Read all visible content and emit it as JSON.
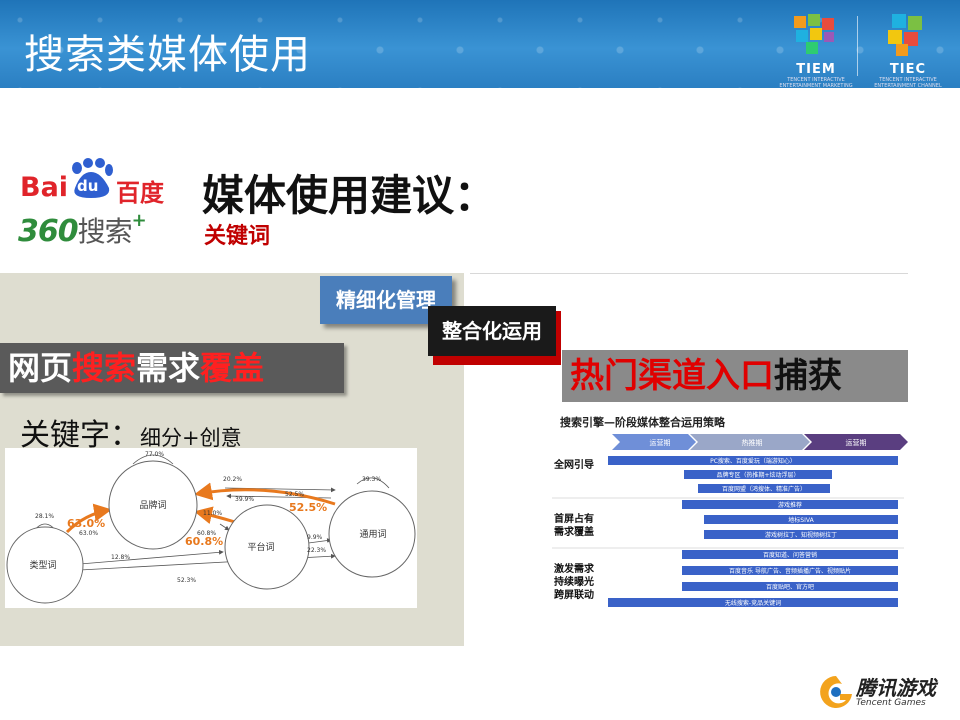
{
  "header": {
    "title": "搜索类媒体使用",
    "logos": [
      {
        "label": "TIEM",
        "sub": "TENCENT INTERACTIVE ENTERTAINMENT MARKETING"
      },
      {
        "label": "TIEC",
        "sub": "TENCENT INTERACTIVE ENTERTAINMENT CHANNEL DEPARTMENT"
      }
    ]
  },
  "brands": {
    "baidu_a": "Bai",
    "baidu_du": "du",
    "baidu_cn": "百度",
    "s360_num": "360",
    "s360_cn": "搜索",
    "s360_plus": "+"
  },
  "main": {
    "heading": "媒体使用建议：",
    "keyword": "关键词"
  },
  "tags": {
    "fine": "精细化管理",
    "integrate": "整合化运用"
  },
  "left": {
    "banner_p1": "网页",
    "banner_p2": "搜索",
    "banner_p3": "需求",
    "banner_p4": "覆盖",
    "kw_label": "关键字：",
    "kw_detail": "细分+创意",
    "network": {
      "nodes": [
        "品牌词",
        "平台词",
        "通用词",
        "类型词"
      ],
      "values": [
        "77.0%",
        "39.3%",
        "28.1%",
        "63.0%",
        "63.0%",
        "20.2%",
        "39.9%",
        "11.0%",
        "52.5%",
        "52.5%",
        "60.8%",
        "60.8%",
        "9.9%",
        "22.3%",
        "12.8%",
        "52.3%"
      ]
    }
  },
  "right": {
    "banner_p1": "热门渠道",
    "banner_p2": "入口",
    "banner_p3": "捕获",
    "strategy": {
      "title": "搜索引擎—阶段媒体整合运用策略",
      "phases": [
        "运营期",
        "热推期",
        "运营期"
      ],
      "rows": [
        {
          "label": "全网引导",
          "bars": [
            "PC搜索、百度爱玩（端游知心）",
            "品牌专区（热推期+炫动浮层）",
            "百度网盟（鸿搜体、精准广告）"
          ]
        },
        {
          "label": "首屏占有\n需求覆盖",
          "bars": [
            "游戏推荐",
            "地标SIVA",
            "游戏树拉丁、知视频树拉丁"
          ]
        },
        {
          "label": "激发需求\n持续曝光\n跨屏联动",
          "bars": [
            "百度知道、问答营销",
            "百度音乐 导航广告、音频插播广告、视频贴片",
            "百度贴吧、官方吧",
            "无线搜索-竞品关键词"
          ]
        }
      ]
    }
  },
  "footer": {
    "brand_cn": "腾讯游戏",
    "brand_en": "Tencent Games"
  },
  "colors": {
    "header_blue": "#2b7fc2",
    "accent_red": "#c00000",
    "tag_blue": "#4a7ebb",
    "arrow_orange": "#e8791e",
    "strategy_blue": "#3a62c8"
  }
}
